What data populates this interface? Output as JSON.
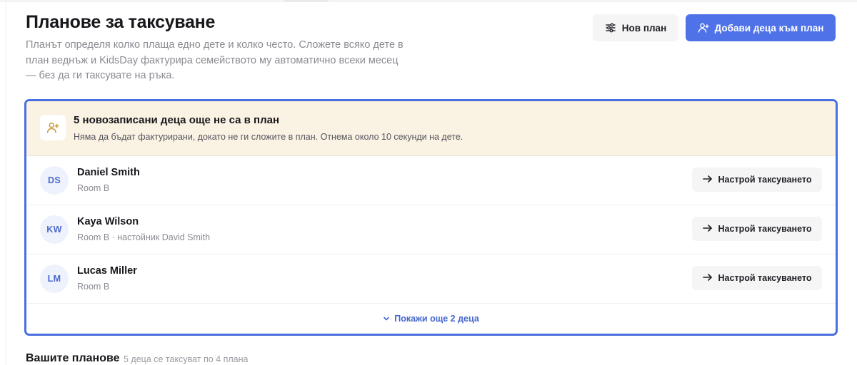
{
  "header": {
    "title": "Планове за таксуване",
    "description": "Планът определя колко плаща едно дете и колко често. Сложете всяко дете в план веднъж и KidsDay фактурира семейството му автоматично всеки месец — без да ги таксувате на ръка.",
    "new_plan_label": "Нов план",
    "new_plan_icon": "sliders-icon",
    "add_children_label": "Добави деца към план",
    "add_children_icon": "user-plus-icon"
  },
  "unassigned": {
    "banner_icon": "user-plus-icon",
    "title": "5 новозаписани деца още не са в план",
    "subtitle": "Няма да бъдат фактурирани, докато не ги сложите в план. Отнема около 10 секунди на дете.",
    "children": [
      {
        "initials": "DS",
        "name": "Daniel Smith",
        "meta": "Room B",
        "action": "Настрой таксуването"
      },
      {
        "initials": "KW",
        "name": "Kaya Wilson",
        "meta": "Room B · настойник David Smith",
        "action": "Настрой таксуването"
      },
      {
        "initials": "LM",
        "name": "Lucas Miller",
        "meta": "Room B",
        "action": "Настрой таксуването"
      }
    ],
    "show_more_label": "Покажи още 2 деца",
    "show_more_icon": "chevron-down-icon"
  },
  "plans_section": {
    "title": "Вашите планове",
    "subtitle": "5 деца се таксуват по 4 плана"
  },
  "colors": {
    "accent": "#4f72e8",
    "focus_border": "#4a6fe0",
    "banner_bg": "#faf3e3",
    "link": "#4466cc"
  }
}
